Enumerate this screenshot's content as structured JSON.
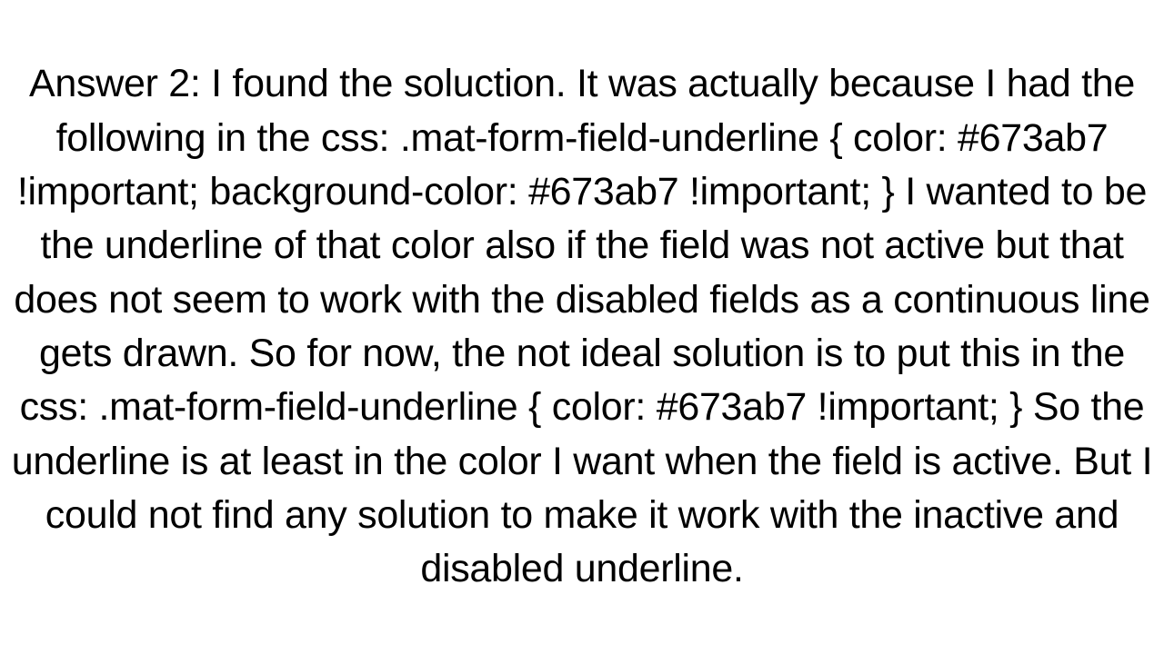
{
  "answer": {
    "text": "Answer 2: I found the soluction. It was actually because I had the following in the css: .mat-form-field-underline {   color: #673ab7 !important;   background-color: #673ab7 !important; }  I wanted to be the underline of that color also if the field was not active but that does not seem to work with the disabled fields as a continuous line gets drawn. So for now, the not ideal solution is to put this in the css: .mat-form-field-underline {   color: #673ab7 !important; }  So the underline is at least in the color I want when the field is active. But I could not find any solution to make it work with the inactive and disabled underline."
  }
}
